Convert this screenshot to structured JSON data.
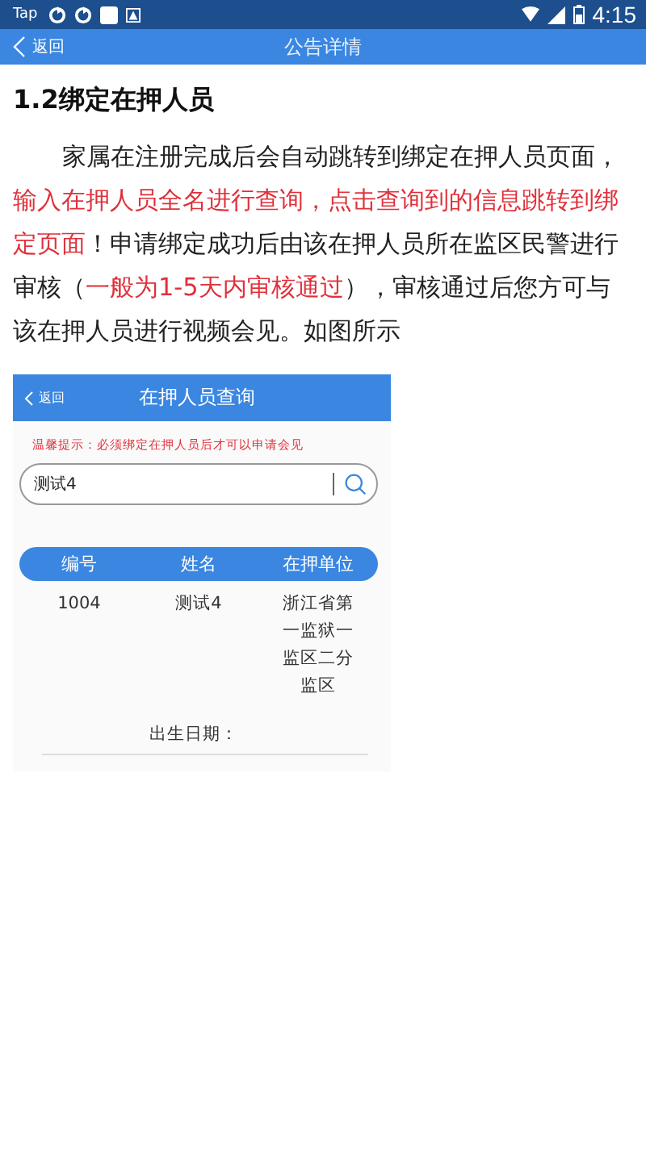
{
  "status_bar": {
    "left": "Tap",
    "time": "4:15"
  },
  "nav_bar": {
    "back": "返回",
    "title": "公告详情"
  },
  "article": {
    "heading": "1.2绑定在押人员",
    "paragraph": [
      {
        "text": "家属在注册完成后会自动跳转到绑定在押人员页面，",
        "highlighted": false
      },
      {
        "text": "输入在押人员全名进行查询，点击查询到的信息跳转到绑定页面",
        "highlighted": true
      },
      {
        "text": "！申请绑定成功后由该在押人员所在监区民警进行审核（",
        "highlighted": false
      },
      {
        "text": "一般为1-5天内审核通过",
        "highlighted": true
      },
      {
        "text": "），审核通过后您方可与该在押人员进行视频会见。如图所示",
        "highlighted": false
      }
    ]
  },
  "screenshot": {
    "nav_bar": {
      "back": "返回",
      "title": "在押人员查询"
    },
    "tip": "温馨提示：必须绑定在押人员后才可以申请会见",
    "search": {
      "value": "测试4"
    },
    "table": {
      "columns": [
        "编号",
        "姓名",
        "在押单位"
      ],
      "rows": [
        [
          "1004",
          "测试4",
          "浙江省第一监狱一监区二分监区"
        ]
      ]
    },
    "birth_label": "出生日期："
  }
}
